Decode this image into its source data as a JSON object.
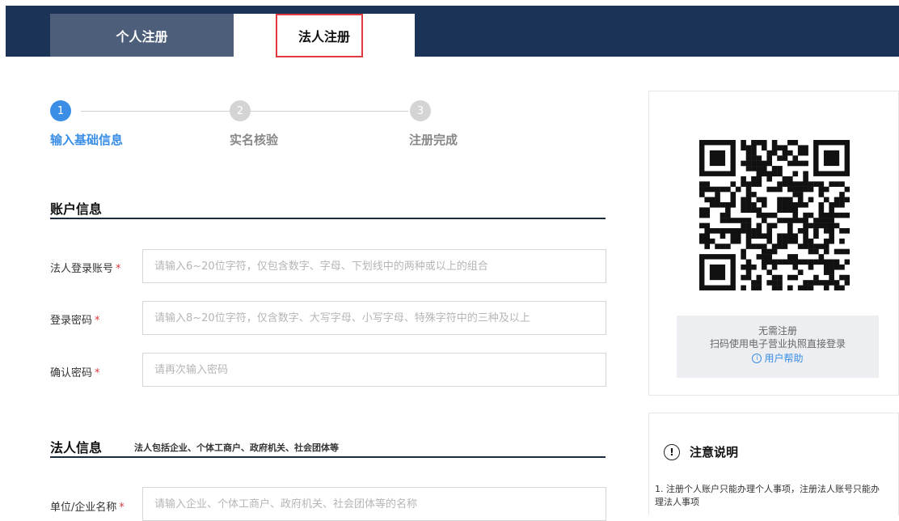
{
  "tabs": {
    "personal": "个人注册",
    "legal": "法人注册"
  },
  "steps": [
    {
      "num": "1",
      "label": "输入基础信息"
    },
    {
      "num": "2",
      "label": "实名核验"
    },
    {
      "num": "3",
      "label": "注册完成"
    }
  ],
  "account_section": {
    "title": "账户信息"
  },
  "fields": {
    "account": {
      "label": "法人登录账号",
      "placeholder": "请输入6~20位字符，仅包含数字、字母、下划线中的两种或以上的组合"
    },
    "password": {
      "label": "登录密码",
      "placeholder": "请输入8~20位字符，仅含数字、大写字母、小写字母、特殊字符中的三种及以上"
    },
    "confirm": {
      "label": "确认密码",
      "placeholder": "请再次输入密码"
    },
    "company": {
      "label": "单位/企业名称",
      "placeholder": "请输入企业、个体工商户、政府机关、社会团体等的名称"
    }
  },
  "required_mark": "*",
  "legal_section": {
    "title": "法人信息",
    "subtitle": "法人包括企业、个体工商户、政府机关、社会团体等"
  },
  "qr_panel": {
    "line1": "无需注册",
    "line2": "扫码使用电子营业执照直接登录",
    "help": "用户帮助",
    "help_icon": "i"
  },
  "notice": {
    "icon": "!",
    "title": "注意说明",
    "text": "1. 注册个人账户只能办理个人事项，注册法人账号只能办理法人事项"
  },
  "colors": {
    "navy": "#1c3358",
    "tab_inactive": "#4d5e7a",
    "accent": "#3a8ee6",
    "required": "#e0393e",
    "highlight_border": "#e0393e"
  }
}
